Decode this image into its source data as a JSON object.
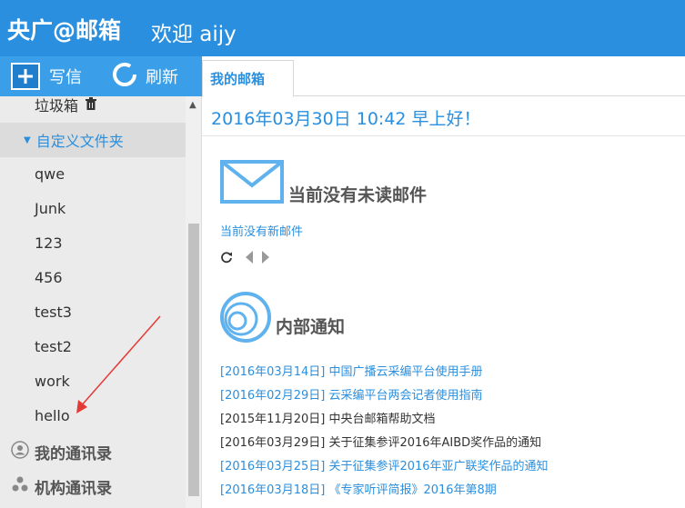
{
  "header": {
    "brand": "央广@邮箱",
    "welcome": "欢迎 aijy"
  },
  "toolbar": {
    "compose_label": "写信",
    "refresh_label": "刷新"
  },
  "sidebar": {
    "trash_label": "垃圾箱",
    "custom_folder_label": "自定义文件夹",
    "folders": [
      "qwe",
      "Junk",
      "123",
      "456",
      "test3",
      "test2",
      "work",
      "hello"
    ],
    "contacts_label": "我的通讯录",
    "org_contacts_label": "机构通讯录"
  },
  "tabs": [
    {
      "label": "我的邮箱"
    }
  ],
  "main": {
    "date_greeting": "2016年03月30日 10:42   早上好！",
    "unread_title": "当前没有未读邮件",
    "no_new_mail": "当前没有新邮件",
    "notice_title": "内部通知",
    "notices": [
      {
        "text": "[2016年03月14日] 中国广播云采编平台使用手册",
        "color": "#2a8fde"
      },
      {
        "text": "[2016年02月29日] 云采编平台两会记者使用指南",
        "color": "#2a8fde"
      },
      {
        "text": "[2015年11月20日] 中央台邮箱帮助文档",
        "color": "#333333"
      },
      {
        "text": "[2016年03月29日] 关于征集参评2016年AIBD奖作品的通知",
        "color": "#333333"
      },
      {
        "text": "[2016年03月25日] 关于征集参评2016年亚广联奖作品的通知",
        "color": "#2a8fde"
      },
      {
        "text": "[2016年03月18日] 《专家听评简报》2016年第8期",
        "color": "#2a8fde"
      }
    ]
  },
  "colors": {
    "accent": "#2a8fde",
    "header_bg": "#2a8fde",
    "toolbar_bg": "#3a9fe8",
    "sidebar_bg": "#ebebeb",
    "annotation_arrow": "#e53935"
  }
}
